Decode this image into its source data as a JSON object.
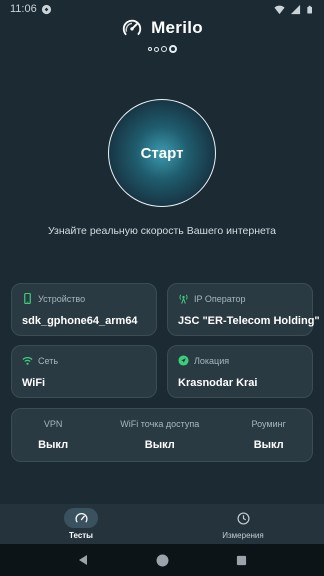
{
  "status_bar": {
    "time": "11:06",
    "icons": [
      "sync-icon",
      "wifi-icon",
      "signal-icon",
      "battery-icon"
    ]
  },
  "header": {
    "title": "Merilo",
    "logo_icon": "speedometer-icon"
  },
  "carousel": {
    "page_count": 4,
    "active_index": 3
  },
  "start_button": {
    "label": "Старт"
  },
  "subtitle": "Узнайте реальную скорость Вашего интернета",
  "cards": {
    "device": {
      "label": "Устройство",
      "value": "sdk_gphone64_arm64",
      "icon": "phone-icon"
    },
    "operator": {
      "label": "IP Оператор",
      "value": "JSC \"ER-Telecom Holding\"",
      "icon": "antenna-icon"
    },
    "network": {
      "label": "Сеть",
      "value": "WiFi",
      "icon": "wifi-icon"
    },
    "location": {
      "label": "Локация",
      "value": "Krasnodar Krai",
      "icon": "location-arrow-icon"
    }
  },
  "features": [
    {
      "label": "VPN",
      "value": "Выкл"
    },
    {
      "label": "WiFi точка доступа",
      "value": "Выкл"
    },
    {
      "label": "Роуминг",
      "value": "Выкл"
    }
  ],
  "bottom_nav": [
    {
      "label": "Тесты",
      "icon": "gauge-icon",
      "active": true
    },
    {
      "label": "Измерения",
      "icon": "clock-icon",
      "active": false
    }
  ],
  "colors": {
    "background": "#1b2a33",
    "card": "#2a3a43",
    "accent_green": "#3ccf7a",
    "start_glow": "#3d9ab0"
  }
}
